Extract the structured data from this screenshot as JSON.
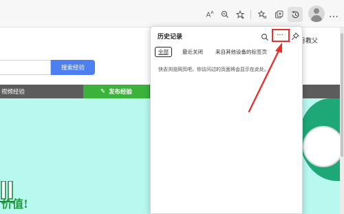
{
  "toolbar": {
    "read_aloud_icon": "Aˢ",
    "zoom_icon": "zoom-out-icon",
    "favorites_icon": "star-add-icon",
    "collections_icon": "favorites-list-icon",
    "extensions_icon": "collections-icon",
    "history_icon": "history-icon",
    "profile_icon": "avatar",
    "more_label": "…"
  },
  "page": {
    "search_button_label": "搜索经验",
    "nav_item_label": "视频经验",
    "publish_button_label": "发布经验",
    "user_name": "橙月教父",
    "hero_text": "价值!",
    "accent_color": "#4d7ff0",
    "publish_color": "#3bb33b",
    "hero_color": "#b7f8ef"
  },
  "history_panel": {
    "title": "历史记录",
    "more_label": "···",
    "tabs": [
      {
        "label": "全部",
        "active": true
      },
      {
        "label": "最近关闭",
        "active": false
      },
      {
        "label": "来自其他设备的标签页",
        "active": false
      }
    ],
    "empty_message": "快去浏览网页吧，你访问过的页面将会显示在此处。"
  },
  "annotation": {
    "highlight_color": "#e8312c"
  }
}
